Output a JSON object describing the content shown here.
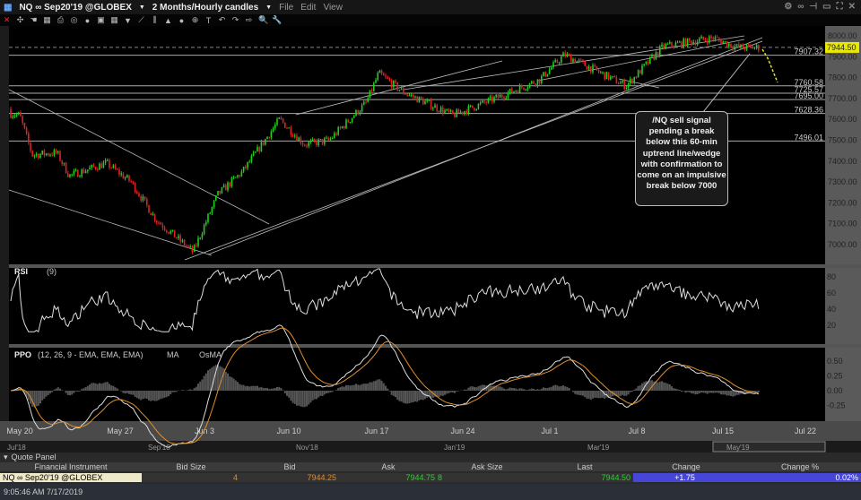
{
  "window": {
    "symbol": "NQ ∞ Sep20'19 @GLOBEX",
    "interval": "2 Months/Hourly candles",
    "menus": [
      "File",
      "Edit",
      "View"
    ]
  },
  "price_axis": {
    "ticks": [
      "8000.00",
      "7900.00",
      "7800.00",
      "7700.00",
      "7600.00",
      "7500.00",
      "7400.00",
      "7300.00",
      "7200.00",
      "7100.00",
      "7000.00"
    ],
    "last": "7944.50",
    "last_color": "#e8e800"
  },
  "levels": [
    {
      "label": "7907.32",
      "v": 7907.32
    },
    {
      "label": "7760.58",
      "v": 7760.58
    },
    {
      "label": "7725.57",
      "v": 7725.57
    },
    {
      "label": "7695.00",
      "v": 7695
    },
    {
      "label": "7628.36",
      "v": 7628.36
    },
    {
      "label": "7496.01",
      "v": 7496.01
    }
  ],
  "annotation": "/NQ sell signal pending a break below this 60-min uptrend line/wedge with confirmation to come on an impulsive break below 7000",
  "rsi": {
    "title": "RSI",
    "param": "(9)",
    "ticks": [
      "80",
      "60",
      "40",
      "20"
    ]
  },
  "ppo": {
    "title": "PPO",
    "param": "(12, 26, 9 - EMA, EMA, EMA)",
    "ma": "MA",
    "osma": "OsMA",
    "ticks": [
      "0.50",
      "0.25",
      "0.00",
      "-0.25"
    ]
  },
  "date_axis": [
    "May 20",
    "May 27",
    "Jun 3",
    "Jun 10",
    "Jun 17",
    "Jun 24",
    "Jul 1",
    "Jul 8",
    "Jul 15",
    "Jul 22"
  ],
  "navigator": [
    "Jul'18",
    "Sep'18",
    "Nov'18",
    "Jan'19",
    "Mar'19",
    "May'19"
  ],
  "quote_panel": {
    "title": "Quote Panel",
    "columns": [
      "Financial Instrument",
      "Bid Size",
      "Bid",
      "Ask",
      "Ask Size",
      "Last",
      "Change",
      "Change %"
    ],
    "row": {
      "instrument": "NQ ∞ Sep20'19 @GLOBEX",
      "bid_size": "4",
      "bid": "7944.25",
      "ask": "7944.75",
      "ask_size": "8",
      "last": "7944.50",
      "change": "+1.75",
      "change_pct": "0.02%"
    }
  },
  "status": "9:05:46 AM 7/17/2019",
  "chart_data": {
    "type": "candlestick",
    "ylim": [
      6950,
      8050
    ],
    "approx_closes": [
      [
        "May 17",
        7650
      ],
      [
        "May 20",
        7620
      ],
      [
        "May 21",
        7430
      ],
      [
        "May 23",
        7440
      ],
      [
        "May 24",
        7330
      ],
      [
        "May 27",
        7390
      ],
      [
        "May 29",
        7300
      ],
      [
        "May 31",
        7120
      ],
      [
        "Jun 3",
        6965
      ],
      [
        "Jun 5",
        7240
      ],
      [
        "Jun 7",
        7350
      ],
      [
        "Jun 10",
        7600
      ],
      [
        "Jun 12",
        7480
      ],
      [
        "Jun 14",
        7500
      ],
      [
        "Jun 17",
        7680
      ],
      [
        "Jun 18",
        7820
      ],
      [
        "Jun 20",
        7730
      ],
      [
        "Jun 24",
        7620
      ],
      [
        "Jun 27",
        7690
      ],
      [
        "Jul 1",
        7790
      ],
      [
        "Jul 3",
        7910
      ],
      [
        "Jul 8",
        7760
      ],
      [
        "Jul 11",
        7950
      ],
      [
        "Jul 15",
        7990
      ],
      [
        "Jul 17",
        7944.5
      ]
    ]
  }
}
